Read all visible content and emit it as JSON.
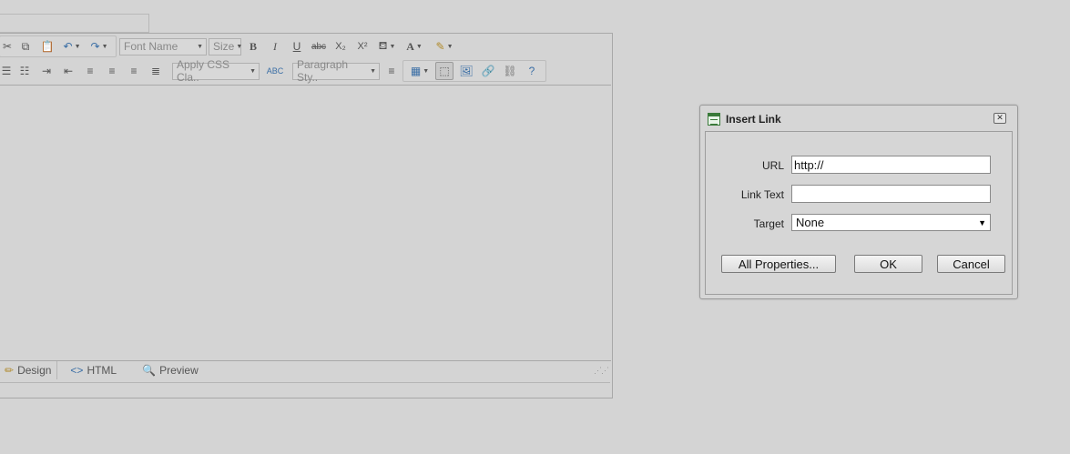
{
  "toolbar": {
    "font_name_placeholder": "Font Name",
    "size_placeholder": "Size",
    "css_class_placeholder": "Apply CSS Cla..",
    "paragraph_style_placeholder": "Paragraph Sty..",
    "bold": "B",
    "italic": "I",
    "underline": "U",
    "strike": "abc",
    "subscript": "X₂",
    "superscript": "X²",
    "font_color": "A"
  },
  "modes": {
    "design": "Design",
    "html": "HTML",
    "preview": "Preview"
  },
  "dialog": {
    "title": "Insert Link",
    "url_label": "URL",
    "url_value": "http://",
    "link_text_label": "Link Text",
    "link_text_value": "",
    "target_label": "Target",
    "target_value": "None",
    "all_properties_button": "All Properties...",
    "ok_button": "OK",
    "cancel_button": "Cancel"
  }
}
